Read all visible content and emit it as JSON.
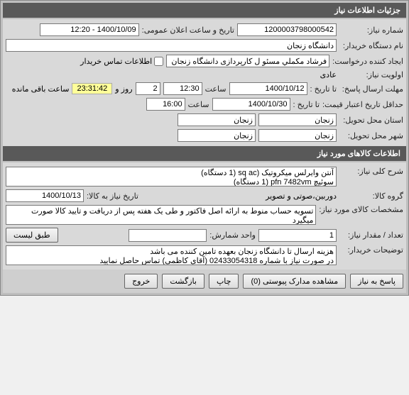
{
  "section1": {
    "title": "جزئیات اطلاعات نیاز",
    "req_no_label": "شماره نیاز:",
    "req_no": "1200003798000542",
    "pub_date_label": "تاریخ و ساعت اعلان عمومی:",
    "pub_date": "1400/10/09 - 12:20",
    "buyer_label": "نام دستگاه خریدار:",
    "buyer": "دانشگاه زنجان",
    "creator_label": "ایجاد کننده درخواست:",
    "creator": "فرشاد مکملي مسئو ل کارپردازی دانشگاه زنجان",
    "contact_chk_label": "اطلاعات تماس خریدار",
    "priority_label": "اولویت نیاز:",
    "priority": "عادی",
    "reply_deadline_label": "مهلت ارسال پاسخ:",
    "to_date_label": "تا تاریخ :",
    "reply_date": "1400/10/12",
    "time_label": "ساعت",
    "reply_time": "12:30",
    "days_remain": "2",
    "days_label": "روز و",
    "countdown": "23:31:42",
    "remain_label": "ساعت باقی مانده",
    "validity_label": "حداقل تاریخ اعتبار قیمت:",
    "validity_date": "1400/10/30",
    "validity_time": "16:00",
    "delivery_province_label": "استان محل تحویل:",
    "delivery_province": "زنجان",
    "delivery_province2": "زنجان",
    "delivery_city_label": "شهر محل تحویل:",
    "delivery_city": "زنجان",
    "delivery_city2": "زنجان"
  },
  "section2": {
    "title": "اطلاعات کالاهای مورد نیاز",
    "desc_label": "شرح کلی نیاز:",
    "desc": "آنتن وایرلس میکروتیک (sq ac (1 دستگاه)\nسوئیچ pfn 7482vm (1 دستگاه)",
    "group_label": "گروه کالا:",
    "group": "دوربین،صوتی و تصویر",
    "need_date_label": "تاریخ نیاز به کالا:",
    "need_date": "1400/10/13",
    "spec_label": "مشخصات کالای مورد نیاز:",
    "spec": "تسویه حساب منوط به ارائه اصل فاکتور و طی یک هفته پس از دریافت و تایید کالا صورت میگیرد",
    "qty_label": "تعداد / مقدار نیاز:",
    "qty": "1",
    "unit_label": "واحد شمارش:",
    "unit": "",
    "per_list_btn": "طبق لیست",
    "buyer_notes_label": "توضیحات خریدار:",
    "buyer_notes": "هزینه ارسال تا دانشگاه زنجان بعهده تامین کننده می باشد\nدر صورت نیاز با شماره 02433054318 (آقای کاظمی) تماس حاصل نمایید"
  },
  "buttons": {
    "reply": "پاسخ به نیاز",
    "attachments": "مشاهده مدارک پیوستی (0)",
    "print": "چاپ",
    "back": "بازگشت",
    "exit": "خروج"
  }
}
